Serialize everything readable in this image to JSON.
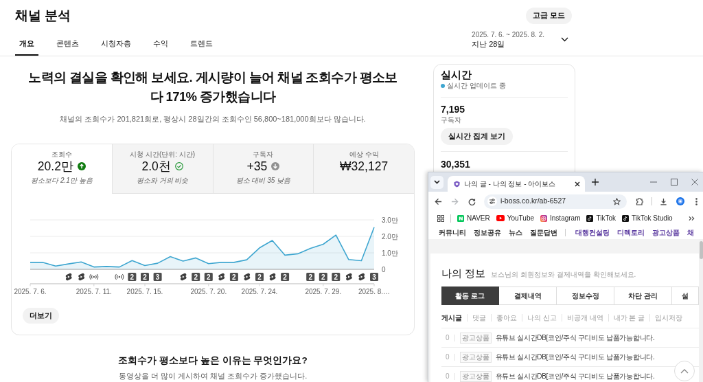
{
  "header": {
    "title": "채널 분석",
    "advanced_button": "고급 모드"
  },
  "tabs": [
    {
      "label": "개요",
      "selected": true
    },
    {
      "label": "콘텐츠",
      "selected": false
    },
    {
      "label": "시청자층",
      "selected": false
    },
    {
      "label": "수익",
      "selected": false
    },
    {
      "label": "트렌드",
      "selected": false
    }
  ],
  "date_range": {
    "dates": "2025. 7. 6. ~ 2025. 8. 2.",
    "period": "지난 28일"
  },
  "summary": {
    "headline": "노력의 결실을 확인해 보세요. 게시량이 늘어 채널 조회수가 평소보다 171% 증가했습니다",
    "detail": "채널의 조회수가 201,821회로, 평상시 28일간의 조회수인 56,800~181,000회보다 많습니다."
  },
  "metrics": [
    {
      "label": "조회수",
      "value": "20.2만",
      "kind": "up",
      "note": "평소보다 2.1만 높음",
      "selected": true
    },
    {
      "label": "시청 시간(단위: 시간)",
      "value": "2.0천",
      "kind": "typical",
      "note": "평소와 거의 비슷",
      "selected": false
    },
    {
      "label": "구독자",
      "value": "+35",
      "kind": "down",
      "note": "평소 대비 35 낮음",
      "selected": false
    },
    {
      "label": "예상 수익",
      "value": "₩32,127",
      "kind": "plain",
      "selected": false
    }
  ],
  "chart": {
    "chart_data": {
      "type": "area",
      "categories": [
        "2025. 7. 6.",
        null,
        null,
        null,
        null,
        "2025. 7. 11.",
        null,
        null,
        null,
        "2025. 7. 15.",
        null,
        null,
        null,
        null,
        "2025. 7. 20.",
        null,
        null,
        null,
        "2025. 7. 24.",
        null,
        null,
        null,
        null,
        "2025. 7. 29.",
        null,
        null,
        null,
        "2025. 8.…"
      ],
      "series": [
        {
          "color": "#3ea6d0",
          "values": [
            0.42,
            0.42,
            0.2,
            0.33,
            0.45,
            0.14,
            0.17,
            0.14,
            0.53,
            0.23,
            0.37,
            0.77,
            0.5,
            0.69,
            0.34,
            0.42,
            0.42,
            0.58,
            1.3,
            1.75,
            0.86,
            0.94,
            1.27,
            1.52,
            2.08,
            0.59,
            0.52,
            2.55
          ]
        }
      ],
      "ylim": [
        0,
        3
      ],
      "yticks": [
        {
          "value": 0,
          "label": "0"
        },
        {
          "value": 1,
          "label": "1.0만"
        },
        {
          "value": 2,
          "label": "2.0만"
        },
        {
          "value": 3,
          "label": "3.0만"
        }
      ]
    },
    "upload_markers": [
      {
        "kind": "none"
      },
      {
        "kind": "none"
      },
      {
        "kind": "none"
      },
      {
        "kind": "shorts"
      },
      {
        "kind": "shorts"
      },
      {
        "kind": "live"
      },
      {
        "kind": "none"
      },
      {
        "kind": "live"
      },
      {
        "kind": "count",
        "label": "2"
      },
      {
        "kind": "count",
        "label": "2"
      },
      {
        "kind": "count",
        "label": "3"
      },
      {
        "kind": "none"
      },
      {
        "kind": "shorts"
      },
      {
        "kind": "count",
        "label": "2"
      },
      {
        "kind": "count",
        "label": "2"
      },
      {
        "kind": "shorts"
      },
      {
        "kind": "count",
        "label": "2"
      },
      {
        "kind": "shorts"
      },
      {
        "kind": "count",
        "label": "2"
      },
      {
        "kind": "shorts"
      },
      {
        "kind": "count",
        "label": "2"
      },
      {
        "kind": "none"
      },
      {
        "kind": "count",
        "label": "2"
      },
      {
        "kind": "count",
        "label": "2"
      },
      {
        "kind": "count",
        "label": "2"
      },
      {
        "kind": "shorts"
      },
      {
        "kind": "shorts"
      },
      {
        "kind": "count",
        "label": "3"
      }
    ]
  },
  "more_button": "더보기",
  "insight": {
    "question": "조회수가 평소보다 높은 이유는 무엇인가요?",
    "answer": "동영상을 더 많이 게시하여 채널 조회수가 증가했습니다."
  },
  "realtime": {
    "title": "실시간",
    "status": "실시간 업데이트 중",
    "subscribers": {
      "value": "7,195",
      "label": "구독자"
    },
    "button": "실시간 집계 보기",
    "views": {
      "value": "30,351"
    }
  },
  "browser": {
    "tab_title": "나의 글 - 나의 정보 - 아이보스",
    "url": "i-boss.co.kr/ab-6527",
    "forward_disabled": true,
    "bookmarks": [
      {
        "label": "NAVER",
        "kind": "naver"
      },
      {
        "label": "YouTube",
        "kind": "youtube"
      },
      {
        "label": "Instagram",
        "kind": "instagram"
      },
      {
        "label": "TikTok",
        "kind": "tiktok"
      },
      {
        "label": "TikTok Studio",
        "kind": "tiktok"
      }
    ],
    "site": {
      "nav": [
        {
          "label": "커뮤니티",
          "kind": "board"
        },
        {
          "label": "정보공유",
          "kind": "board"
        },
        {
          "label": "뉴스",
          "kind": "board"
        },
        {
          "label": "질문답변",
          "kind": "board"
        },
        {
          "label": "대행컨설팅",
          "kind": "business"
        },
        {
          "label": "디렉토리",
          "kind": "business"
        },
        {
          "label": "광고상품",
          "kind": "business"
        },
        {
          "label": "채",
          "kind": "business"
        }
      ],
      "title": "나의 정보",
      "subtitle": "보스님의 회원정보와 결제내역을 확인해보세요.",
      "tabs": [
        {
          "label": "활동 로그",
          "selected": true
        },
        {
          "label": "결제내역",
          "selected": false
        },
        {
          "label": "정보수정",
          "selected": false
        },
        {
          "label": "차단 관리",
          "selected": false
        },
        {
          "label": "설",
          "selected": false
        }
      ],
      "filters": [
        {
          "label": "게시글",
          "selected": true
        },
        {
          "label": "댓글",
          "selected": false
        },
        {
          "label": "좋아요",
          "selected": false
        },
        {
          "label": "나의 신고",
          "selected": false
        },
        {
          "label": "비공개 내역",
          "selected": false
        },
        {
          "label": "내가 본 글",
          "selected": false
        },
        {
          "label": "임시저장",
          "selected": false
        }
      ],
      "posts": [
        {
          "count": "0",
          "tag": "광고상품",
          "title": "유튜브 실시간DB[코인/주식 구디비도 납품가능합니다."
        },
        {
          "count": "0",
          "tag": "광고상품",
          "title": "유튜브 실시간DB[코인/주식 구디비도 납품가능합니다."
        },
        {
          "count": "0",
          "tag": "광고상품",
          "title": "유튜브 실시간DB[코인/주식 구디비도 납품가능합니다."
        }
      ]
    }
  }
}
